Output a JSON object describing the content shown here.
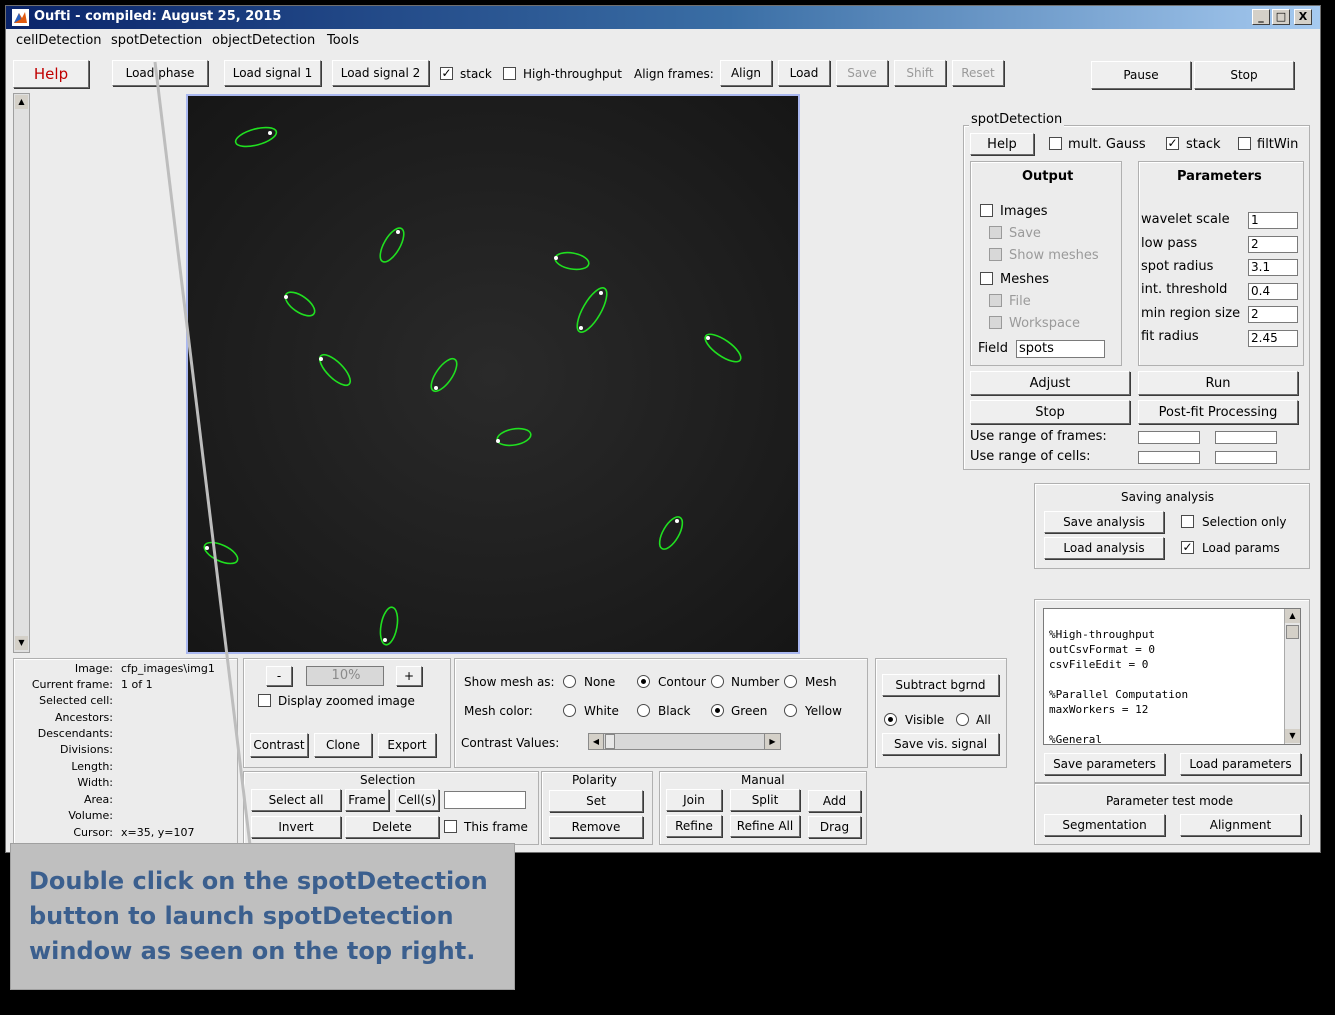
{
  "window": {
    "title": "Oufti - compiled:  August 25, 2015",
    "min": "_",
    "max": "□",
    "close": "X"
  },
  "menu": [
    "cellDetection",
    "spotDetection",
    "objectDetection",
    "Tools"
  ],
  "toolbar": {
    "help": "Help",
    "load_phase": "Load phase",
    "load_signal1": "Load signal 1",
    "load_signal2": "Load signal 2",
    "stack": "stack",
    "high_throughput": "High-throughput",
    "align_frames": "Align frames:",
    "align": "Align",
    "load": "Load",
    "save": "Save",
    "shift": "Shift",
    "reset": "Reset",
    "pause": "Pause",
    "stop": "Stop"
  },
  "spot_panel": {
    "title": "spotDetection",
    "help": "Help",
    "mult_gauss": "mult. Gauss",
    "stack": "stack",
    "filtwin": "filtWin",
    "output": {
      "title": "Output",
      "images": "Images",
      "save": "Save",
      "show_meshes": "Show meshes",
      "meshes": "Meshes",
      "file": "File",
      "workspace": "Workspace",
      "field_label": "Field",
      "field_value": "spots"
    },
    "parameters": {
      "title": "Parameters",
      "items": [
        {
          "label": "wavelet scale",
          "value": "1"
        },
        {
          "label": "low pass",
          "value": "2"
        },
        {
          "label": "spot radius",
          "value": "3.1"
        },
        {
          "label": "int. threshold",
          "value": "0.4"
        },
        {
          "label": "min region size",
          "value": "2"
        },
        {
          "label": "fit radius",
          "value": "2.45"
        }
      ]
    },
    "adjust": "Adjust",
    "run": "Run",
    "stop": "Stop",
    "postfit": "Post-fit Processing",
    "range_frames": "Use range of frames:",
    "range_cells": "Use range of cells:"
  },
  "saving": {
    "title": "Saving analysis",
    "save_analysis": "Save analysis",
    "load_analysis": "Load analysis",
    "selection_only": "Selection only",
    "load_params": "Load params"
  },
  "params_text": [
    "%High-throughput",
    "outCsvFormat = 0",
    "csvFileEdit = 0",
    "",
    "%Parallel Computation",
    "maxWorkers = 12",
    "",
    "%General"
  ],
  "params_buttons": {
    "save": "Save parameters",
    "load": "Load parameters"
  },
  "test_mode": {
    "title": "Parameter test mode",
    "segmentation": "Segmentation",
    "alignment": "Alignment"
  },
  "info": {
    "labels": [
      "Image:",
      "Current frame:",
      "Selected cell:",
      "Ancestors:",
      "Descendants:",
      "Divisions:",
      "Length:",
      "Width:",
      "Area:",
      "Volume:",
      "Cursor:"
    ],
    "values": [
      "cfp_images\\img1",
      "1 of 1",
      "",
      "",
      "",
      "",
      "",
      "",
      "",
      "",
      "x=35, y=107"
    ]
  },
  "zoom": {
    "minus": "-",
    "value": "10%",
    "plus": "+",
    "display_zoomed": "Display zoomed image",
    "contrast": "Contrast",
    "clone": "Clone",
    "export": "Export"
  },
  "mesh": {
    "show_as": "Show mesh as:",
    "options": [
      "None",
      "Contour",
      "Number",
      "Mesh"
    ],
    "selected_show": "Contour",
    "color_label": "Mesh color:",
    "colors": [
      "White",
      "Black",
      "Green",
      "Yellow"
    ],
    "selected_color": "Green",
    "contrast_values": "Contrast Values:"
  },
  "bg": {
    "subtract": "Subtract bgrnd",
    "visible": "Visible",
    "all": "All",
    "save_vis": "Save vis. signal"
  },
  "selection": {
    "title": "Selection",
    "select_all": "Select all",
    "frame": "Frame",
    "cells": "Cell(s)",
    "invert": "Invert",
    "delete": "Delete",
    "this_frame": "This frame"
  },
  "polarity": {
    "title": "Polarity",
    "set": "Set",
    "remove": "Remove"
  },
  "manual": {
    "title": "Manual",
    "join": "Join",
    "split": "Split",
    "add": "Add",
    "refine": "Refine",
    "refine_all": "Refine All",
    "drag": "Drag"
  },
  "callout": "Double click on the spotDetection button to launch spotDetection window as seen on the top right."
}
